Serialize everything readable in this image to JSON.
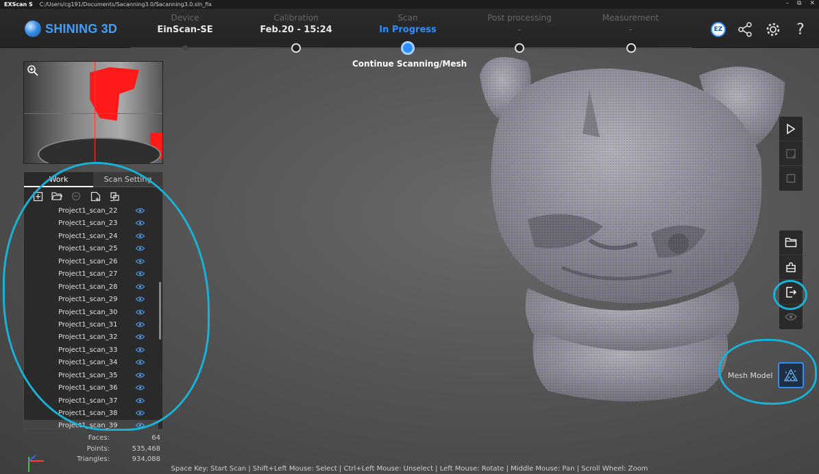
{
  "titlebar": {
    "app": "EXScan S",
    "path": "C:/Users/cg191/Documents/Sacanning3.0/Sacanning3.0.sln_fix",
    "minimize": "–",
    "maximize": "⧉",
    "close": "✕"
  },
  "header": {
    "brand": "SHINING 3D",
    "steps": [
      {
        "label": "Device",
        "value": "EinScan-SE",
        "state": "done"
      },
      {
        "label": "Calibration",
        "value": "Feb.20 - 15:24",
        "state": "done"
      },
      {
        "label": "Scan",
        "value": "In Progress",
        "state": "active"
      },
      {
        "label": "Post processing",
        "value": "-",
        "state": "pending"
      },
      {
        "label": "Measurement",
        "value": "-",
        "state": "pending"
      }
    ],
    "continue_label": "Continue Scanning/Mesh",
    "ez_label": "EZ"
  },
  "panel": {
    "tabs": [
      "Work",
      "Scan Setting"
    ],
    "active_tab": "Work",
    "scans": [
      "Project1_scan_22",
      "Project1_scan_23",
      "Project1_scan_24",
      "Project1_scan_25",
      "Project1_scan_26",
      "Project1_scan_27",
      "Project1_scan_28",
      "Project1_scan_29",
      "Project1_scan_30",
      "Project1_scan_31",
      "Project1_scan_32",
      "Project1_scan_33",
      "Project1_scan_34",
      "Project1_scan_35",
      "Project1_scan_36",
      "Project1_scan_37",
      "Project1_scan_38",
      "Project1_scan_39"
    ],
    "selected_scan": "Project1_scan_39"
  },
  "stats": {
    "faces_label": "Faces:",
    "faces": "64",
    "points_label": "Points:",
    "points": "535,468",
    "triangles_label": "Triangles:",
    "triangles": "934,088"
  },
  "right_toolbar": {
    "mesh_label": "Mesh Model"
  },
  "hint": "Space Key: Start Scan | Shift+Left Mouse: Select | Ctrl+Left Mouse: Unselect | Left Mouse: Rotate | Middle Mouse: Pan | Scroll Wheel: Zoom",
  "colors": {
    "accent": "#2d8fff",
    "annotation": "#19b2d6",
    "preview_highlight": "#ff1a1a"
  }
}
